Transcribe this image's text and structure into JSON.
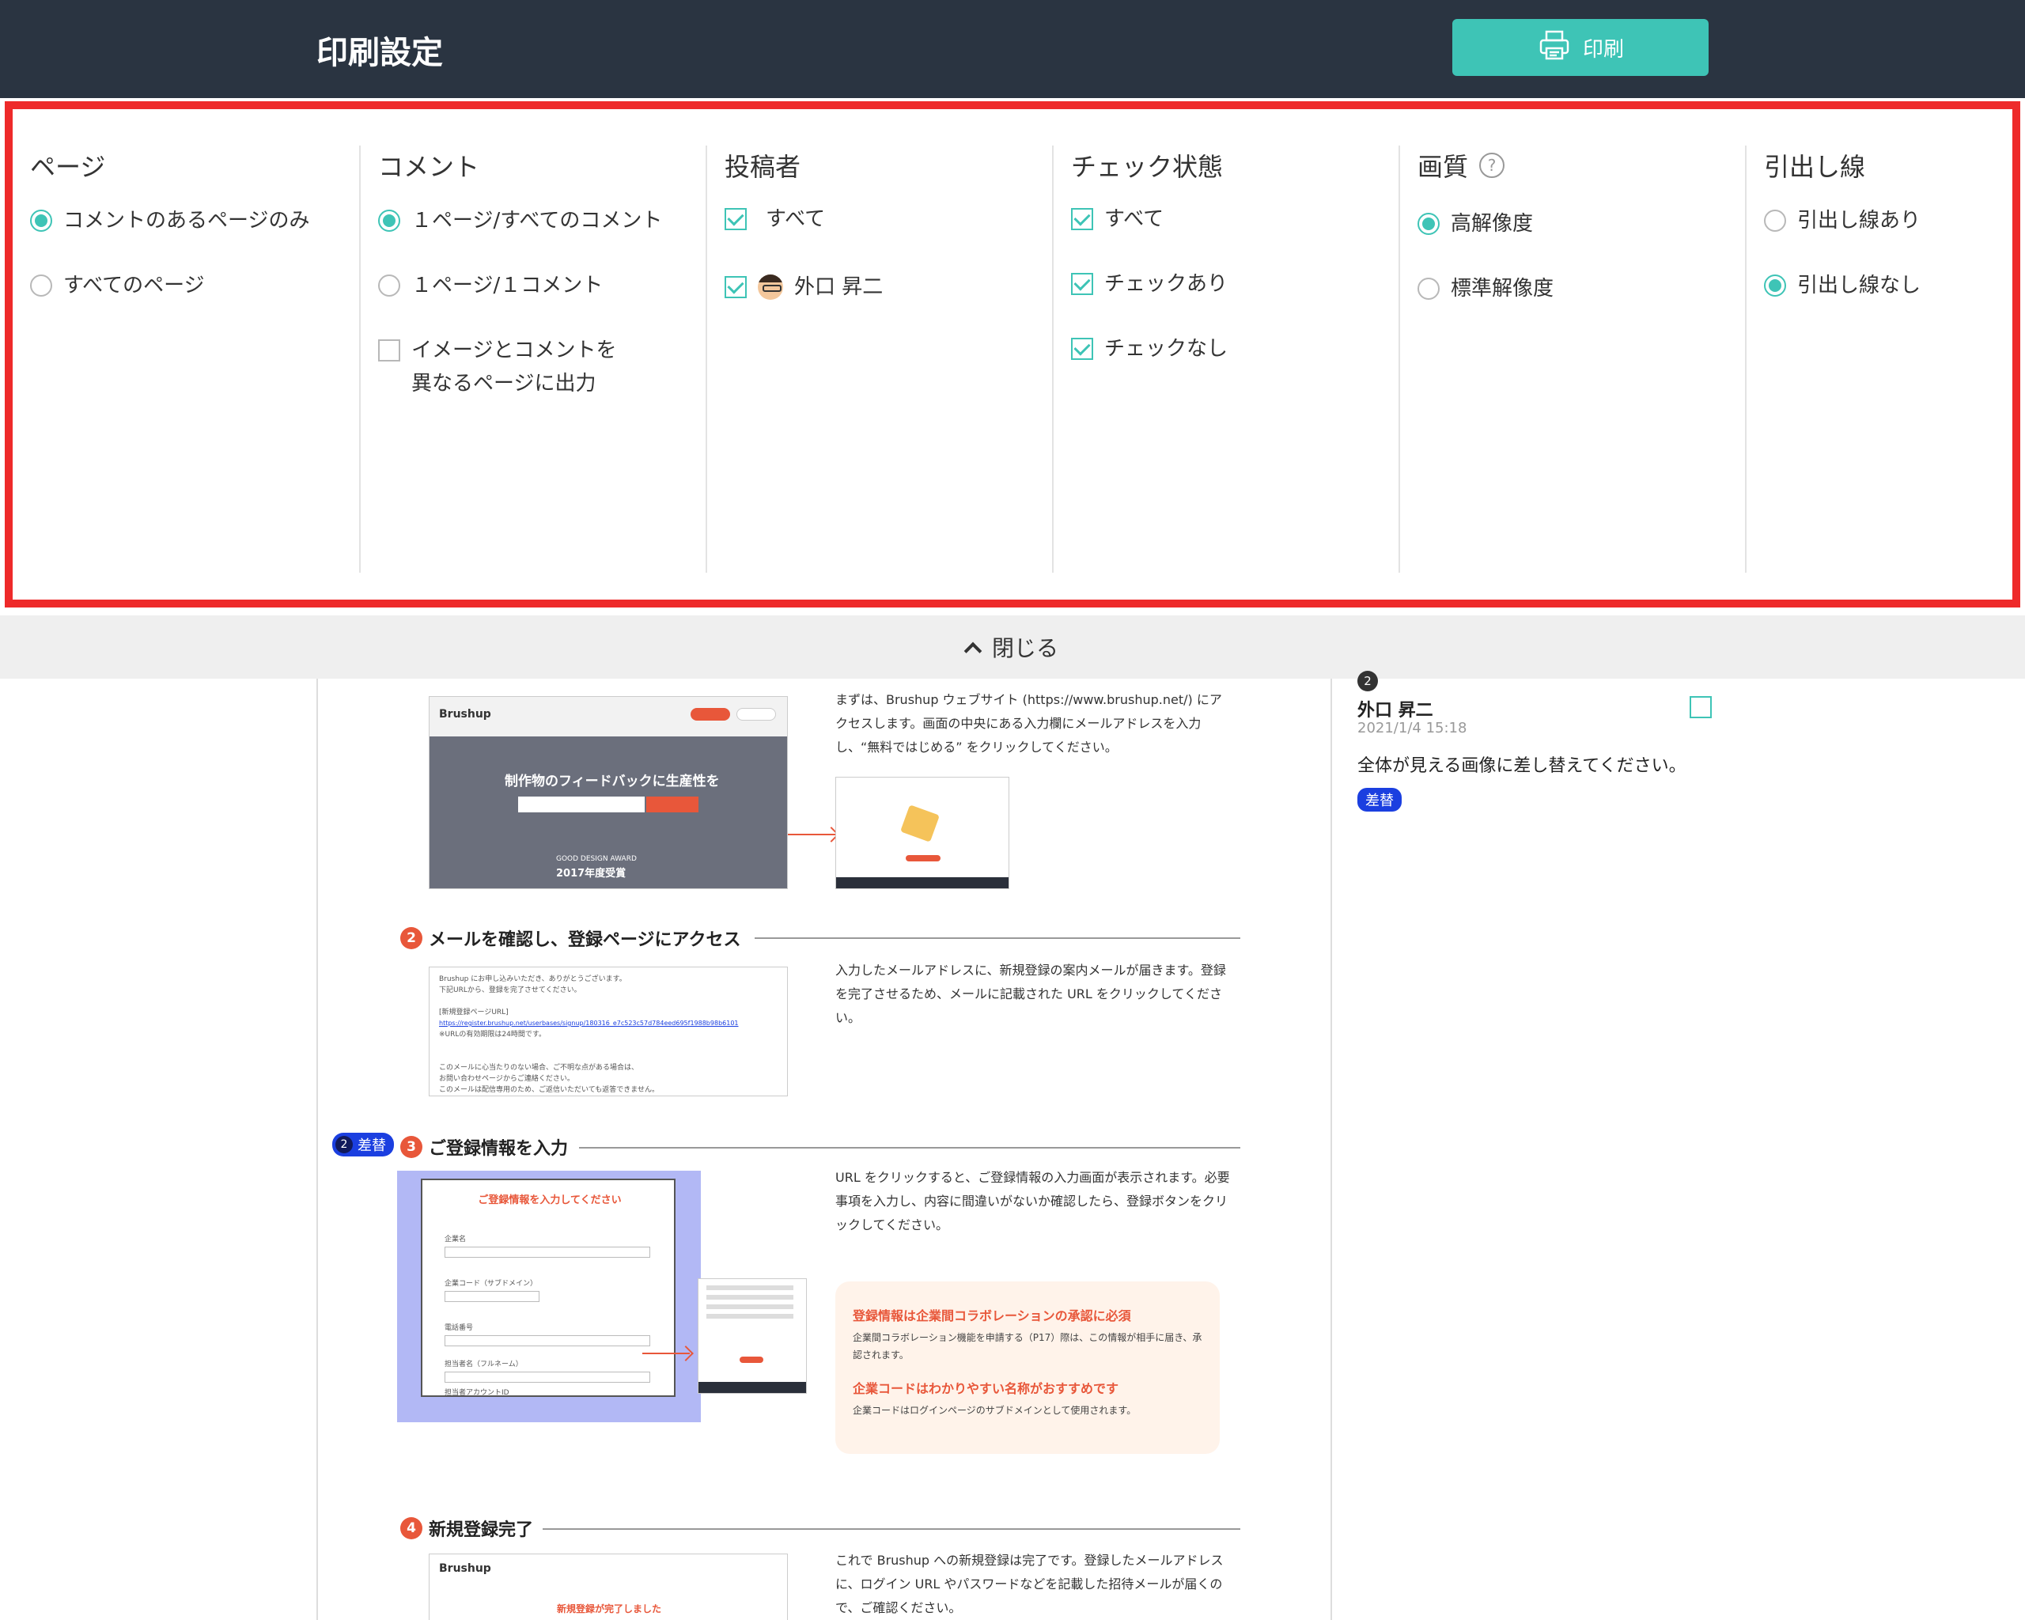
{
  "header": {
    "title": "印刷設定",
    "print_label": "印刷"
  },
  "settings": {
    "page": {
      "label": "ページ",
      "options": [
        "コメントのあるページのみ",
        "すべてのページ"
      ]
    },
    "comment": {
      "label": "コメント",
      "options": [
        "１ページ/すべてのコメント",
        "１ページ/１コメント"
      ],
      "checkbox_line1": "イメージとコメントを",
      "checkbox_line2": "異なるページに出力"
    },
    "poster": {
      "label": "投稿者",
      "options": [
        "すべて",
        "外口 昇二"
      ]
    },
    "check_state": {
      "label": "チェック状態",
      "options": [
        "すべて",
        "チェックあり",
        "チェックなし"
      ]
    },
    "quality": {
      "label": "画質",
      "help_icon": "?",
      "options": [
        "高解像度",
        "標準解像度"
      ]
    },
    "leader": {
      "label": "引出し線",
      "options": [
        "引出し線あり",
        "引出し線なし"
      ]
    }
  },
  "close_label": "閉じる",
  "doc": {
    "step1_text": "まずは、Brushup ウェブサイト (https://www.brushup.net/) にアクセスします。画面の中央にある入力欄にメールアドレスを入力し、“無料ではじめる” をクリックしてください。",
    "shot1": {
      "logo": "Brushup",
      "headline": "制作物のフィードバックに生産性を",
      "award1": "GOOD DESIGN AWARD",
      "award2": "2017年度受賞"
    },
    "step2": {
      "num": "2",
      "title": "メールを確認し、登録ページにアクセス"
    },
    "step2_text": "入力したメールアドレスに、新規登録の案内メールが届きます。登録を完了させるため、メールに記載された URL をクリックしてください。",
    "email_lines": [
      "Brushup にお申し込みいただき、ありがとうございます。",
      "下記URLから、登録を完了させてください。",
      "",
      "[新規登録ページURL]",
      "https://register.brushup.net/userbases/signup/180316_e7c523c57d784eed695f1988b98b6101",
      "※URLの有効期限は24時間です。",
      "",
      "",
      "このメールに心当たりのない場合、ご不明な点がある場合は、",
      "お問い合わせページからご連絡ください。",
      "このメールは配信専用のため、ご返信いただいても返答できません。"
    ],
    "annotation": {
      "num": "2",
      "label": "差替"
    },
    "step3": {
      "num": "3",
      "title": "ご登録情報を入力"
    },
    "step3_text": "URL をクリックすると、ご登録情報の入力画面が表示されます。必要事項を入力し、内容に間違いがないか確認したら、登録ボタンをクリックしてください。",
    "form_title": "ご登録情報を入力してください",
    "form_fields": [
      "企業名",
      "企業コード（サブドメイン）",
      "電話番号",
      "担当者名（フルネーム）",
      "担当者アカウントID"
    ],
    "tip": {
      "title1": "登録情報は企業間コラボレーションの承認に必須",
      "text1": "企業間コラボレーション機能を申請する（P17）際は、この情報が相手に届き、承認されます。",
      "title2": "企業コードはわかりやすい名称がおすすめです",
      "text2": "企業コードはログインページのサブドメインとして使用されます。"
    },
    "step4": {
      "num": "4",
      "title": "新規登録完了"
    },
    "step4_text": "これで Brushup への新規登録は完了です。登録したメールアドレスに、ログイン URL やパスワードなどを記載した招待メールが届くので、ご確認ください。",
    "shot4": {
      "logo": "Brushup",
      "text": "新規登録が完了しました"
    }
  },
  "comment_panel": {
    "num": "2",
    "name": "外口 昇二",
    "date": "2021/1/4 15:18",
    "body": "全体が見える画像に差し替えてください。",
    "tag": "差替"
  },
  "colors": {
    "accent": "#3ec4b6",
    "header_bg": "#2a3441",
    "highlight": "#ee2a2a",
    "step_num": "#e8573a",
    "tag_blue": "#1b3fe0"
  }
}
